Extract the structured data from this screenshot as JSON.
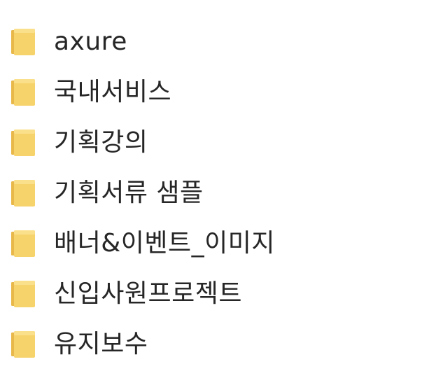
{
  "folders": [
    {
      "name": "axure",
      "icon": "folder-icon"
    },
    {
      "name": "국내서비스",
      "icon": "folder-icon"
    },
    {
      "name": "기획강의",
      "icon": "folder-icon"
    },
    {
      "name": "기획서류 샘플",
      "icon": "folder-icon"
    },
    {
      "name": "배너&이벤트_이미지",
      "icon": "folder-icon"
    },
    {
      "name": "신입사원프로젝트",
      "icon": "folder-icon"
    },
    {
      "name": "유지보수",
      "icon": "folder-icon"
    }
  ],
  "colors": {
    "folder_front": "#F7D36B",
    "folder_back": "#E8B84A",
    "text": "#262626",
    "background": "#FFFFFF"
  }
}
